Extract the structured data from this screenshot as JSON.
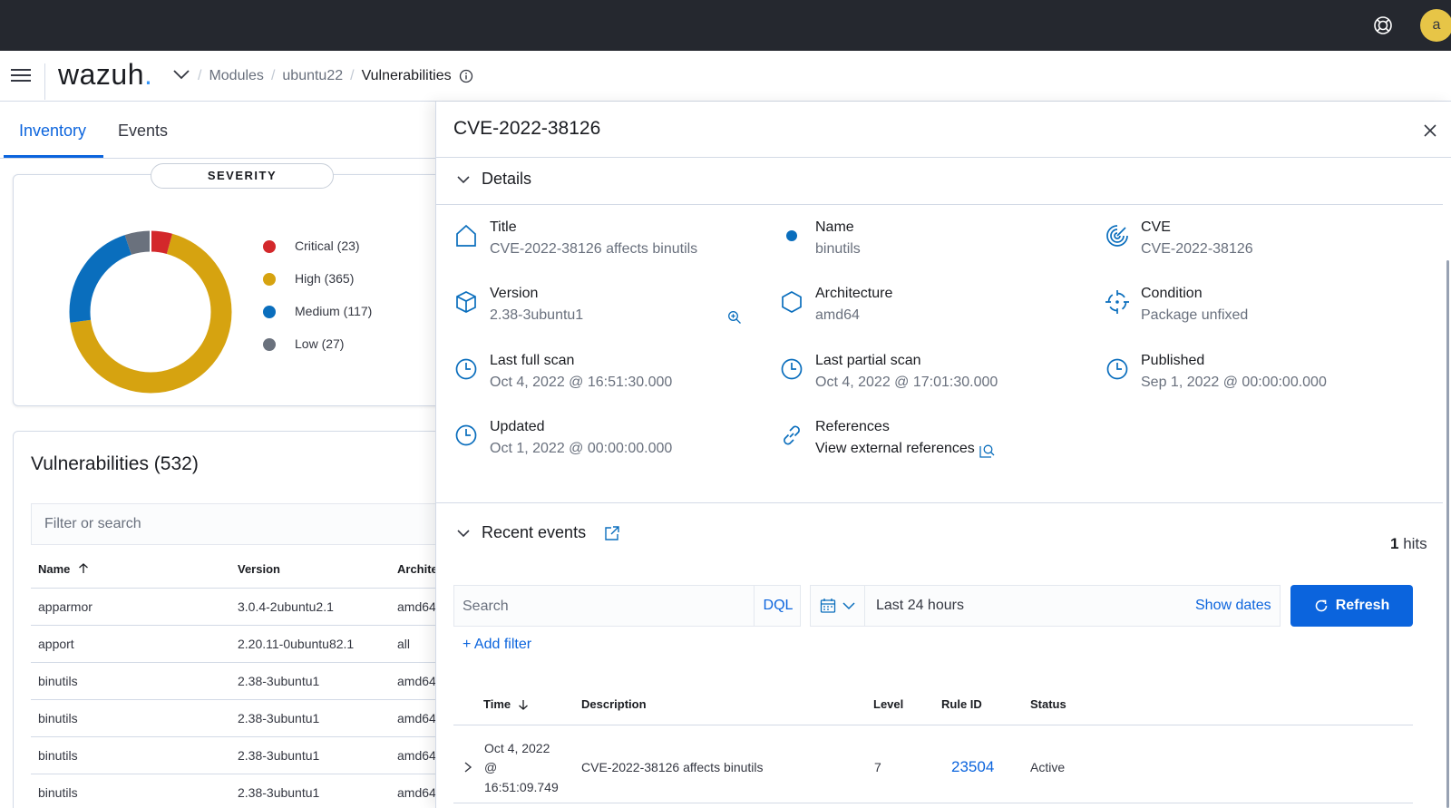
{
  "topbar": {
    "avatar_letter": "a",
    "help_icon": "help-lifebuoy-icon"
  },
  "header": {
    "logo": "wazuh",
    "logo_dot": ".",
    "breadcrumbs": [
      "Modules",
      "ubuntu22",
      "Vulnerabilities"
    ]
  },
  "tabs": [
    {
      "label": "Inventory",
      "active": true
    },
    {
      "label": "Events",
      "active": false
    }
  ],
  "severity": {
    "title": "SEVERITY",
    "legend": [
      {
        "label": "Critical (23)",
        "color": "#d3282b"
      },
      {
        "label": "High (365)",
        "color": "#d6a310"
      },
      {
        "label": "Medium (117)",
        "color": "#0a6ebd"
      },
      {
        "label": "Low (27)",
        "color": "#6a717d"
      }
    ]
  },
  "vulnerabilities": {
    "title": "Vulnerabilities (532)",
    "filter_placeholder": "Filter or search",
    "columns": [
      "Name",
      "Version",
      "Archite"
    ],
    "rows": [
      {
        "name": "apparmor",
        "version": "3.0.4-2ubuntu2.1",
        "arch": "amd64"
      },
      {
        "name": "apport",
        "version": "2.20.11-0ubuntu82.1",
        "arch": "all"
      },
      {
        "name": "binutils",
        "version": "2.38-3ubuntu1",
        "arch": "amd64"
      },
      {
        "name": "binutils",
        "version": "2.38-3ubuntu1",
        "arch": "amd64"
      },
      {
        "name": "binutils",
        "version": "2.38-3ubuntu1",
        "arch": "amd64"
      },
      {
        "name": "binutils",
        "version": "2.38-3ubuntu1",
        "arch": "amd64"
      }
    ]
  },
  "flyout": {
    "title": "CVE-2022-38126",
    "details_heading": "Details",
    "details": {
      "title": {
        "label": "Title",
        "value": "CVE-2022-38126 affects binutils",
        "icon": "home-icon"
      },
      "name": {
        "label": "Name",
        "value": "binutils",
        "icon": "dot-icon"
      },
      "cve": {
        "label": "CVE",
        "value": "CVE-2022-38126",
        "icon": "radar-icon"
      },
      "version": {
        "label": "Version",
        "value": "2.38-3ubuntu1",
        "icon": "package-icon"
      },
      "architecture": {
        "label": "Architecture",
        "value": "amd64",
        "icon": "hexagon-icon"
      },
      "condition": {
        "label": "Condition",
        "value": "Package unfixed",
        "icon": "crosshair-icon"
      },
      "last_full_scan": {
        "label": "Last full scan",
        "value": "Oct 4, 2022 @ 16:51:30.000",
        "icon": "clock-icon"
      },
      "last_partial_scan": {
        "label": "Last partial scan",
        "value": "Oct 4, 2022 @ 17:01:30.000",
        "icon": "clock-icon"
      },
      "published": {
        "label": "Published",
        "value": "Sep 1, 2022 @ 00:00:00.000",
        "icon": "clock-icon"
      },
      "updated": {
        "label": "Updated",
        "value": "Oct 1, 2022 @ 00:00:00.000",
        "icon": "clock-icon"
      },
      "references": {
        "label": "References",
        "value": "View external references",
        "icon": "link-icon"
      }
    },
    "recent_events": {
      "heading": "Recent events",
      "hits_count": "1",
      "hits_label": "hits",
      "search_placeholder": "Search",
      "dql_label": "DQL",
      "date_range": "Last 24 hours",
      "show_dates": "Show dates",
      "refresh_label": "Refresh",
      "add_filter": "+ Add filter",
      "columns": [
        "Time",
        "Description",
        "Level",
        "Rule ID",
        "Status"
      ],
      "rows": [
        {
          "time_line1": "Oct 4, 2022",
          "time_line2": "@",
          "time_line3": "16:51:09.749",
          "description": "CVE-2022-38126 affects binutils",
          "level": "7",
          "rule_id": "23504",
          "status": "Active"
        }
      ]
    }
  },
  "colors": {
    "accent": "#0b64dd",
    "topbar": "#25282f",
    "avatar": "#e7c547"
  }
}
